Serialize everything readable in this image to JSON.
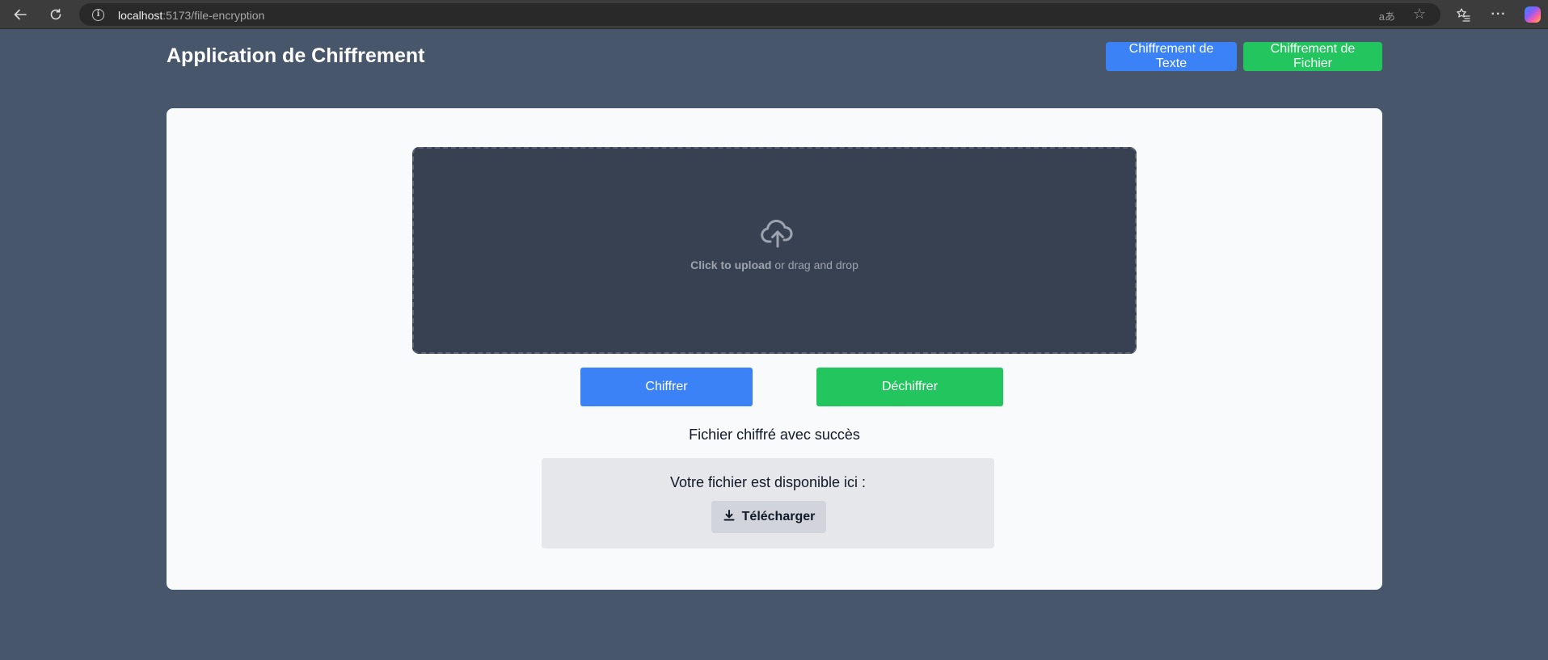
{
  "browser": {
    "url_host": "localhost",
    "url_path": ":5173/file-encryption",
    "info_symbol": "i",
    "readaloud_symbol": "aあ",
    "more_symbol": "···"
  },
  "header": {
    "title": "Application de Chiffrement",
    "nav_text_label": "Chiffrement de Texte",
    "nav_file_label": "Chiffrement de Fichier"
  },
  "upload": {
    "icon": "cloud-upload-icon",
    "click_label": "Click to upload",
    "rest_label": " or drag and drop"
  },
  "actions": {
    "encrypt_label": "Chiffrer",
    "decrypt_label": "Déchiffrer"
  },
  "result": {
    "status": "Fichier chiffré avec succès",
    "available_label": "Votre fichier est disponible ici :",
    "download_label": "Télécharger",
    "download_icon": "download-icon"
  },
  "colors": {
    "blue": "#3b82f6",
    "green": "#22c55e",
    "page_bg": "#47566b",
    "dropzone_bg": "#374151"
  }
}
